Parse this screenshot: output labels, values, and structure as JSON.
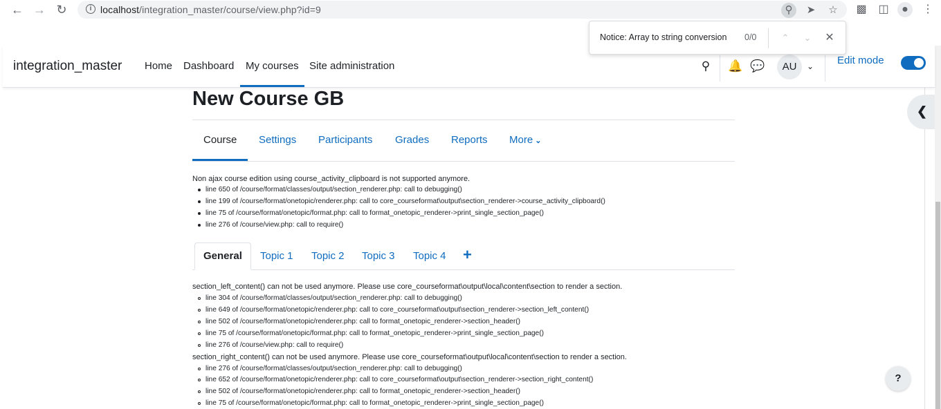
{
  "browser": {
    "url_host": "localhost",
    "url_path": "/integration_master/course/view.php?id=9",
    "back_icon": "arrow-left-icon",
    "forward_icon": "arrow-right-icon",
    "reload_icon": "reload-icon"
  },
  "find_bar": {
    "query": "Notice: Array to string conversion",
    "count": "0/0"
  },
  "navbar": {
    "site_name": "integration_master",
    "items": [
      "Home",
      "Dashboard",
      "My courses",
      "Site administration"
    ],
    "active_item": "My courses",
    "avatar_initials": "AU",
    "edit_mode_label": "Edit mode",
    "edit_mode_on": true
  },
  "course": {
    "title": "New Course GB",
    "tabs": [
      "Course",
      "Settings",
      "Participants",
      "Grades",
      "Reports",
      "More"
    ],
    "active_tab": "Course"
  },
  "debug_blocks": {
    "clipboard": {
      "message": "Non ajax course edition using course_activity_clipboard is not supported anymore.",
      "lines": [
        "line 650 of /course/format/classes/output/section_renderer.php: call to debugging()",
        "line 199 of /course/format/onetopic/renderer.php: call to core_courseformat\\output\\section_renderer->course_activity_clipboard()",
        "line 75 of /course/format/onetopic/format.php: call to format_onetopic_renderer->print_single_section_page()",
        "line 276 of /course/view.php: call to require()"
      ]
    },
    "left_content": {
      "message": "section_left_content() can not be used anymore. Please use core_courseformat\\output\\local\\content\\section to render a section.",
      "lines": [
        "line 304 of /course/format/classes/output/section_renderer.php: call to debugging()",
        "line 649 of /course/format/onetopic/renderer.php: call to core_courseformat\\output\\section_renderer->section_left_content()",
        "line 502 of /course/format/onetopic/renderer.php: call to format_onetopic_renderer->section_header()",
        "line 75 of /course/format/onetopic/format.php: call to format_onetopic_renderer->print_single_section_page()",
        "line 276 of /course/view.php: call to require()"
      ]
    },
    "right_content": {
      "message": "section_right_content() can not be used anymore. Please use core_courseformat\\output\\local\\content\\section to render a section.",
      "lines": [
        "line 276 of /course/format/classes/output/section_renderer.php: call to debugging()",
        "line 652 of /course/format/onetopic/renderer.php: call to core_courseformat\\output\\section_renderer->section_right_content()",
        "line 502 of /course/format/onetopic/renderer.php: call to format_onetopic_renderer->section_header()",
        "line 75 of /course/format/onetopic/format.php: call to format_onetopic_renderer->print_single_section_page()"
      ]
    }
  },
  "topics": {
    "tabs": [
      "General",
      "Topic 1",
      "Topic 2",
      "Topic 3",
      "Topic 4"
    ],
    "active_tab": "General",
    "add_label": "+"
  },
  "help_label": "?",
  "colors": {
    "accent": "#0f6cbf",
    "text": "#1d2125",
    "border": "#dee2e6"
  }
}
